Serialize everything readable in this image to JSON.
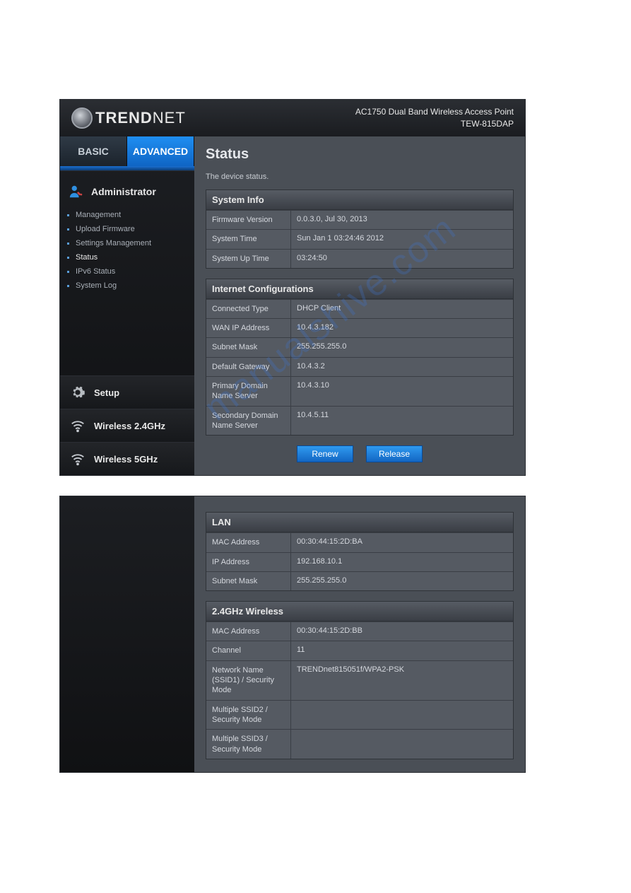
{
  "brand": {
    "name_strong": "TREND",
    "name_light": "NET"
  },
  "product": {
    "line": "AC1750 Dual Band Wireless Access Point",
    "model": "TEW-815DAP"
  },
  "tabs": {
    "basic": "BASIC",
    "advanced": "ADVANCED"
  },
  "page": {
    "title": "Status",
    "description": "The device status."
  },
  "sidebar": {
    "administrator": "Administrator",
    "items": [
      {
        "label": "Management"
      },
      {
        "label": "Upload Firmware"
      },
      {
        "label": "Settings Management"
      },
      {
        "label": "Status"
      },
      {
        "label": "IPv6 Status"
      },
      {
        "label": "System Log"
      }
    ],
    "setup": "Setup",
    "w24": "Wireless 2.4GHz",
    "w5": "Wireless 5GHz"
  },
  "buttons": {
    "renew": "Renew",
    "release": "Release"
  },
  "sections": {
    "system_info": {
      "title": "System Info",
      "rows": [
        {
          "k": "Firmware Version",
          "v": "0.0.3.0, Jul 30, 2013"
        },
        {
          "k": "System Time",
          "v": "Sun Jan 1 03:24:46 2012"
        },
        {
          "k": "System Up Time",
          "v": "03:24:50"
        }
      ]
    },
    "internet": {
      "title": "Internet Configurations",
      "rows": [
        {
          "k": "Connected Type",
          "v": "DHCP Client"
        },
        {
          "k": "WAN IP Address",
          "v": "10.4.3.182"
        },
        {
          "k": "Subnet Mask",
          "v": "255.255.255.0"
        },
        {
          "k": "Default Gateway",
          "v": "10.4.3.2"
        },
        {
          "k": "Primary Domain Name Server",
          "v": "10.4.3.10"
        },
        {
          "k": "Secondary Domain Name Server",
          "v": "10.4.5.11"
        }
      ]
    },
    "lan": {
      "title": "LAN",
      "rows": [
        {
          "k": "MAC Address",
          "v": "00:30:44:15:2D:BA"
        },
        {
          "k": "IP Address",
          "v": "192.168.10.1"
        },
        {
          "k": "Subnet Mask",
          "v": "255.255.255.0"
        }
      ]
    },
    "w24": {
      "title": "2.4GHz Wireless",
      "rows": [
        {
          "k": "MAC Address",
          "v": "00:30:44:15:2D:BB"
        },
        {
          "k": "Channel",
          "v": "11"
        },
        {
          "k": "Network Name (SSID1) / Security Mode",
          "v": "TRENDnet815051f/WPA2-PSK"
        },
        {
          "k": "Multiple SSID2 / Security Mode",
          "v": ""
        },
        {
          "k": "Multiple SSID3 / Security Mode",
          "v": ""
        }
      ]
    }
  },
  "watermark": "manualshive.com"
}
